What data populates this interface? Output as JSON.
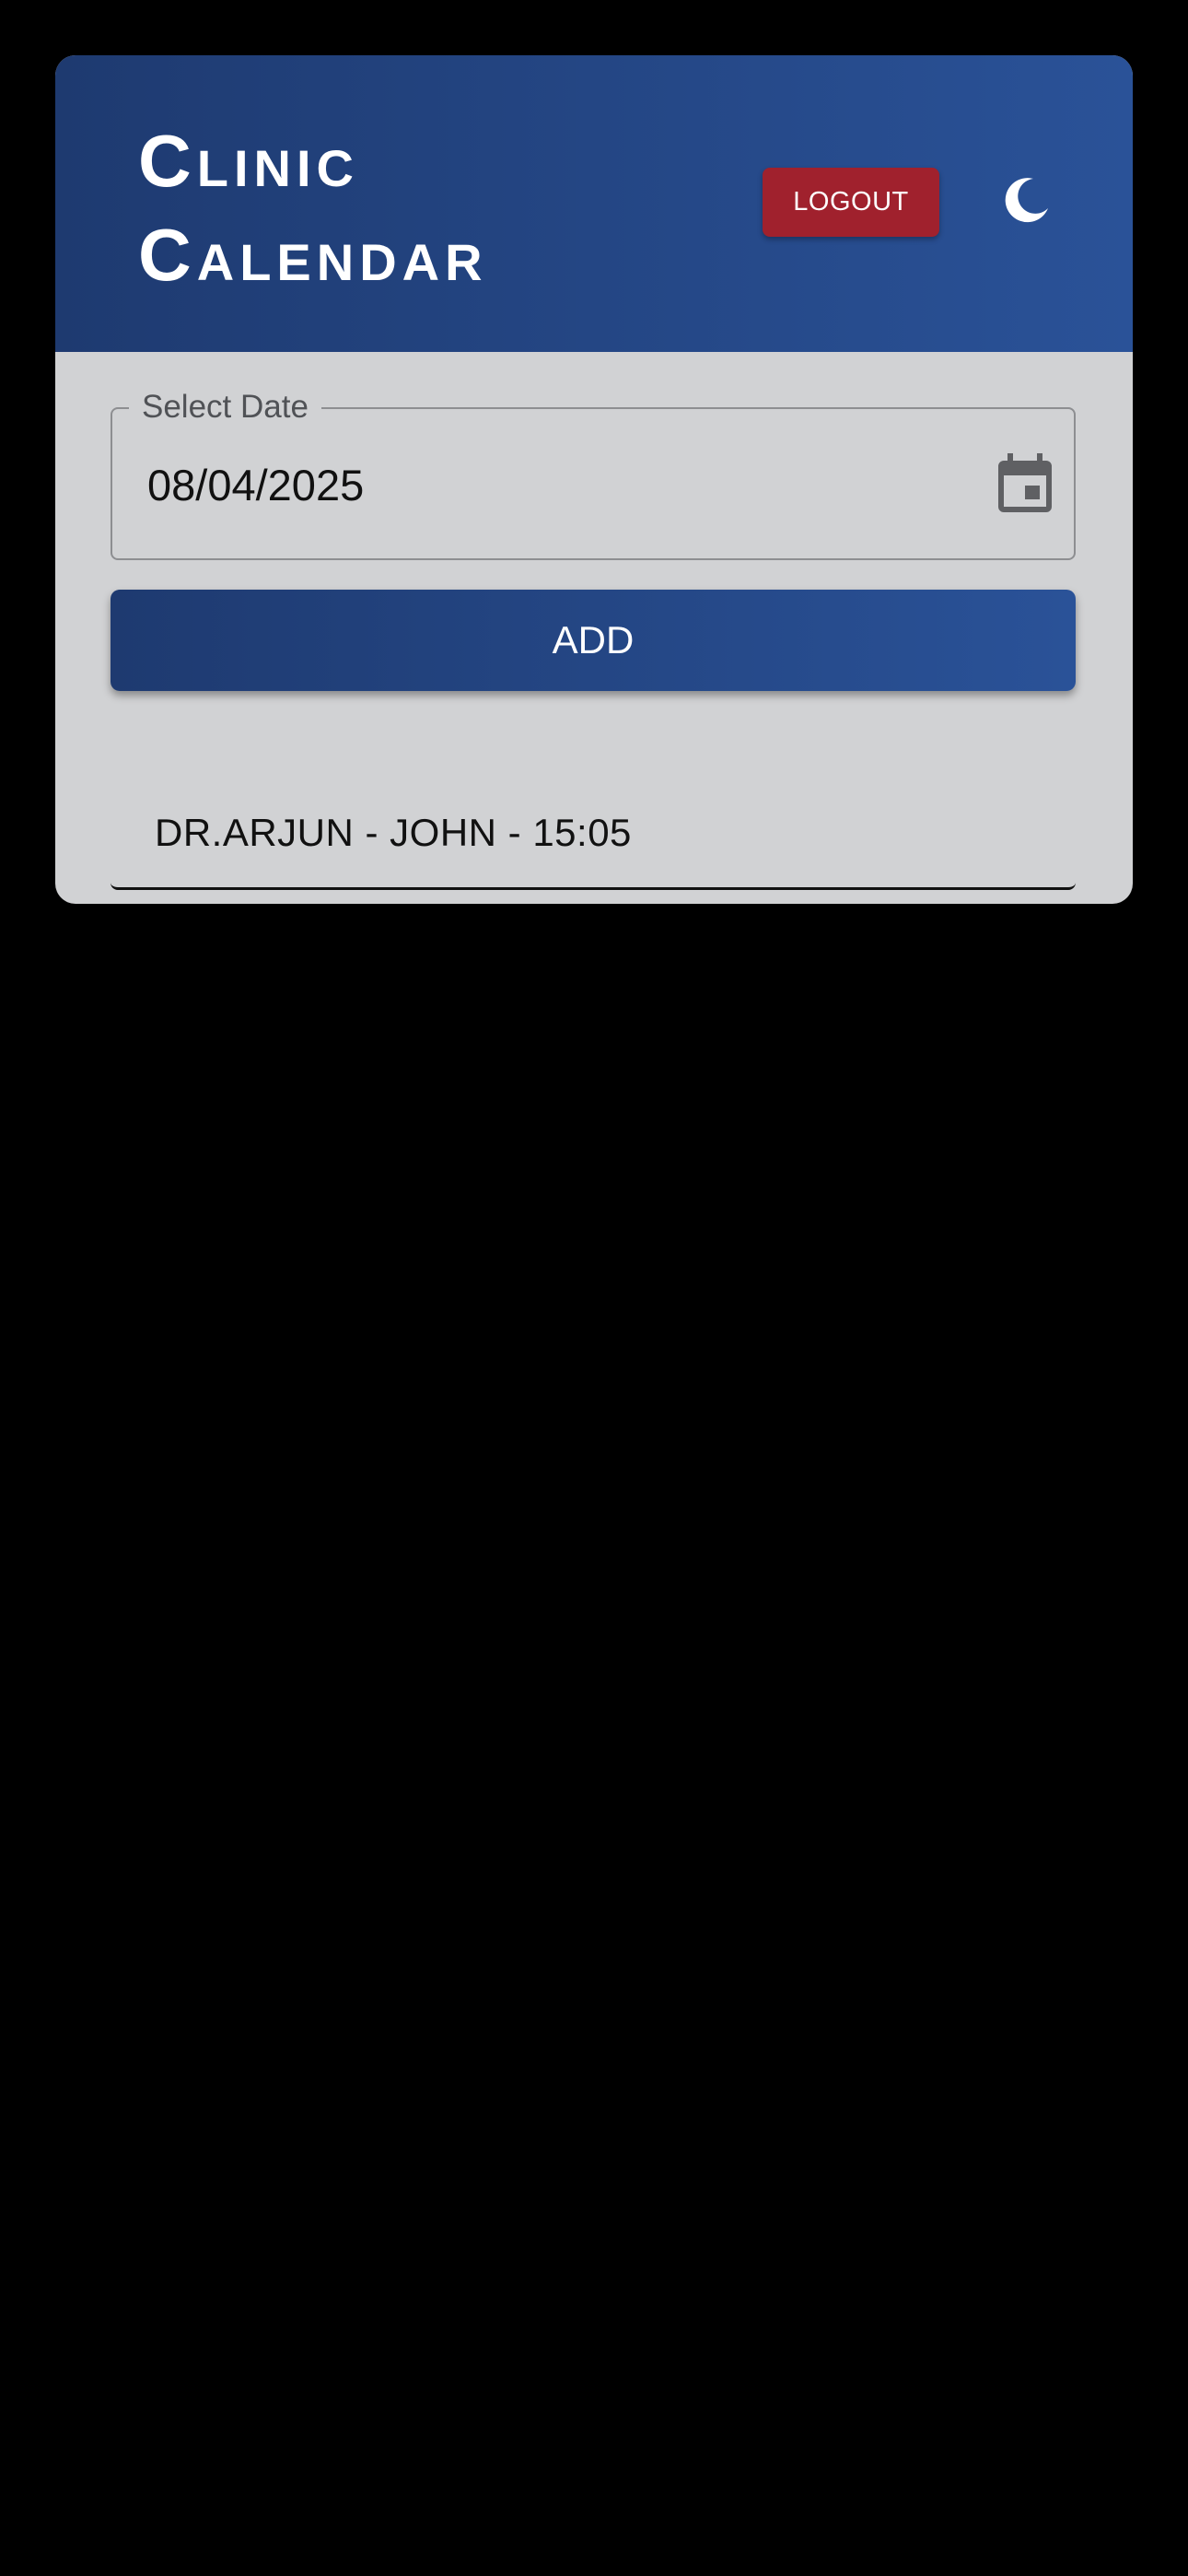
{
  "app": {
    "title_line1": "Clinic",
    "title_line2": "Calendar"
  },
  "header": {
    "logout_label": "LOGOUT",
    "theme_icon": "moon-icon"
  },
  "date_picker": {
    "label": "Select Date",
    "value": "08/04/2025",
    "icon": "calendar-icon"
  },
  "actions": {
    "add_label": "ADD"
  },
  "appointments": [
    {
      "text": "DR.ARJUN - JOHN - 15:05"
    }
  ],
  "colors": {
    "header_gradient_start": "#1e3a70",
    "header_gradient_end": "#2a5298",
    "logout_bg": "#a0212d",
    "card_bg": "#d1d2d4",
    "page_bg": "#000000"
  }
}
